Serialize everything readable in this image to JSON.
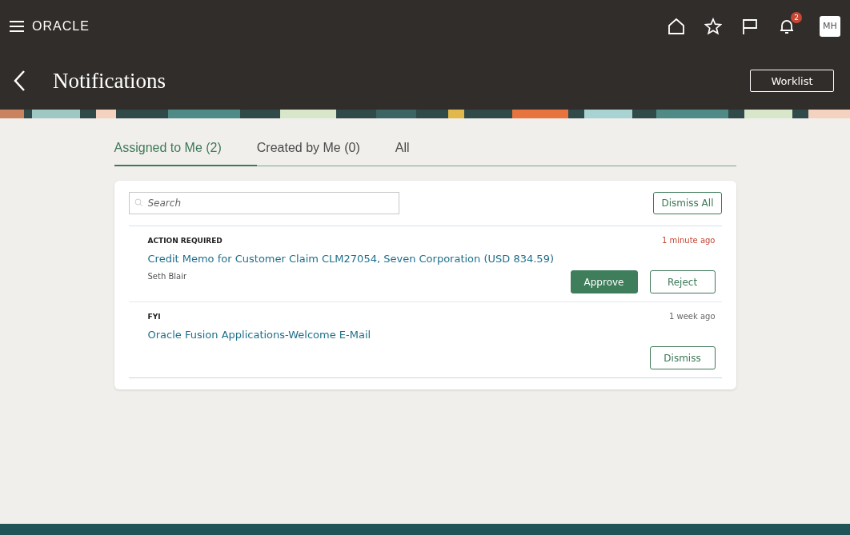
{
  "header": {
    "logo": "ORACLE",
    "notification_count": "2",
    "avatar": "MH"
  },
  "page": {
    "title": "Notifications",
    "worklist_button": "Worklist"
  },
  "tabs": [
    {
      "label": "Assigned to Me (2)",
      "selected": true
    },
    {
      "label": "Created by Me (0)",
      "selected": false
    },
    {
      "label": "All",
      "selected": false
    }
  ],
  "search": {
    "placeholder": "Search"
  },
  "dismiss_all": "Dismiss All",
  "notifications": [
    {
      "category": "ACTION REQUIRED",
      "time": "1 minute ago",
      "recent": true,
      "title": "Credit Memo for Customer Claim CLM27054, Seven Corporation (USD 834.59)",
      "sender": "Seth Blair",
      "buttons": [
        {
          "label": "Approve",
          "kind": "primary"
        },
        {
          "label": "Reject",
          "kind": "secondary"
        }
      ]
    },
    {
      "category": "FYI",
      "time": "1 week ago",
      "recent": false,
      "title": "Oracle Fusion Applications-Welcome E-Mail",
      "buttons": [
        {
          "label": "Dismiss",
          "kind": "secondary"
        }
      ]
    }
  ]
}
